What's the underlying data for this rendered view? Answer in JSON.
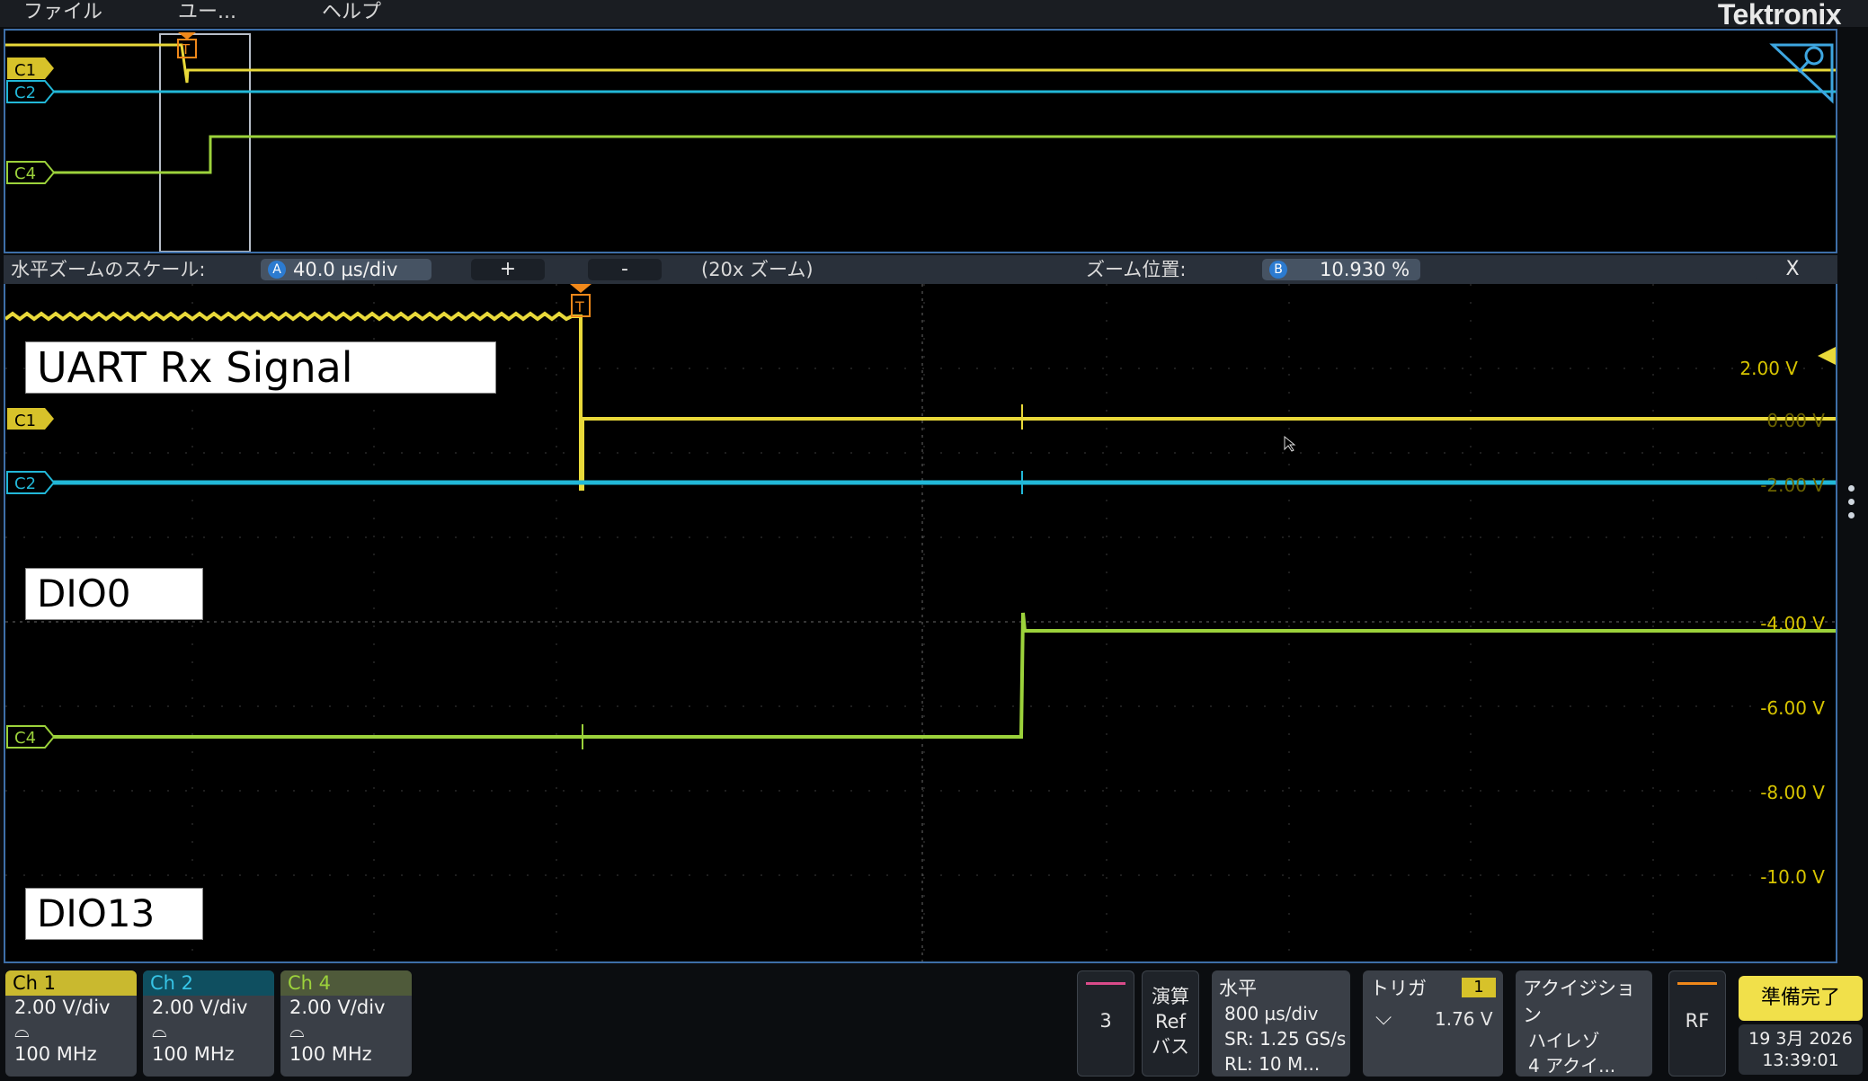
{
  "menu": {
    "file": "ファイル",
    "utility": "ユー...",
    "help": "ヘルプ"
  },
  "brand": "Tektronix",
  "overview": {
    "c1": "C1",
    "c2": "C2",
    "c4": "C4",
    "trigger": "T"
  },
  "zoombar": {
    "scale_label": "水平ズームのスケール:",
    "scale_badge": "A",
    "scale_value": "40.0 µs/div",
    "plus": "+",
    "minus": "-",
    "zoom_factor": "(20x ズーム)",
    "pos_label": "ズーム位置:",
    "pos_badge": "B",
    "pos_value": "10.930 %",
    "close": "X"
  },
  "main": {
    "c1": "C1",
    "c2": "C2",
    "c4": "C4",
    "trigger": "T",
    "annotations": {
      "uart": "UART Rx Signal",
      "dio0": "DIO0",
      "dio13": "DIO13"
    },
    "volts": {
      "v1": "2.00 V",
      "v2": "0.00 V",
      "v3": "-2.00 V",
      "v4": "-4.00 V",
      "v5": "-6.00 V",
      "v6": "-8.00 V",
      "v7": "-10.0 V"
    }
  },
  "channels": [
    {
      "name": "Ch 1",
      "scale": "2.00 V/div",
      "bw": "100 MHz",
      "color": "#e9d93a"
    },
    {
      "name": "Ch 2",
      "scale": "2.00 V/div",
      "bw": "100 MHz",
      "color": "#22b8d8"
    },
    {
      "name": "Ch 4",
      "scale": "2.00 V/div",
      "bw": "100 MHz",
      "color": "#9cd23b"
    }
  ],
  "bottom": {
    "slot3": "3",
    "math": [
      "演算",
      "Ref",
      "バス"
    ],
    "horiz": {
      "title": "水平",
      "l1": "800 µs/div",
      "l2": "SR: 1.25 GS/s",
      "l3": "RL: 10 M..."
    },
    "trigger": {
      "title": "トリガ",
      "src": "1",
      "level": "1.76 V"
    },
    "acq": {
      "title": "アクイジション",
      "l1": "ハイレゾ",
      "l2": "4 アクイ..."
    },
    "rf": "RF",
    "ready": "準備完了",
    "date": "19 3月 2026",
    "time": "13:39:01"
  }
}
